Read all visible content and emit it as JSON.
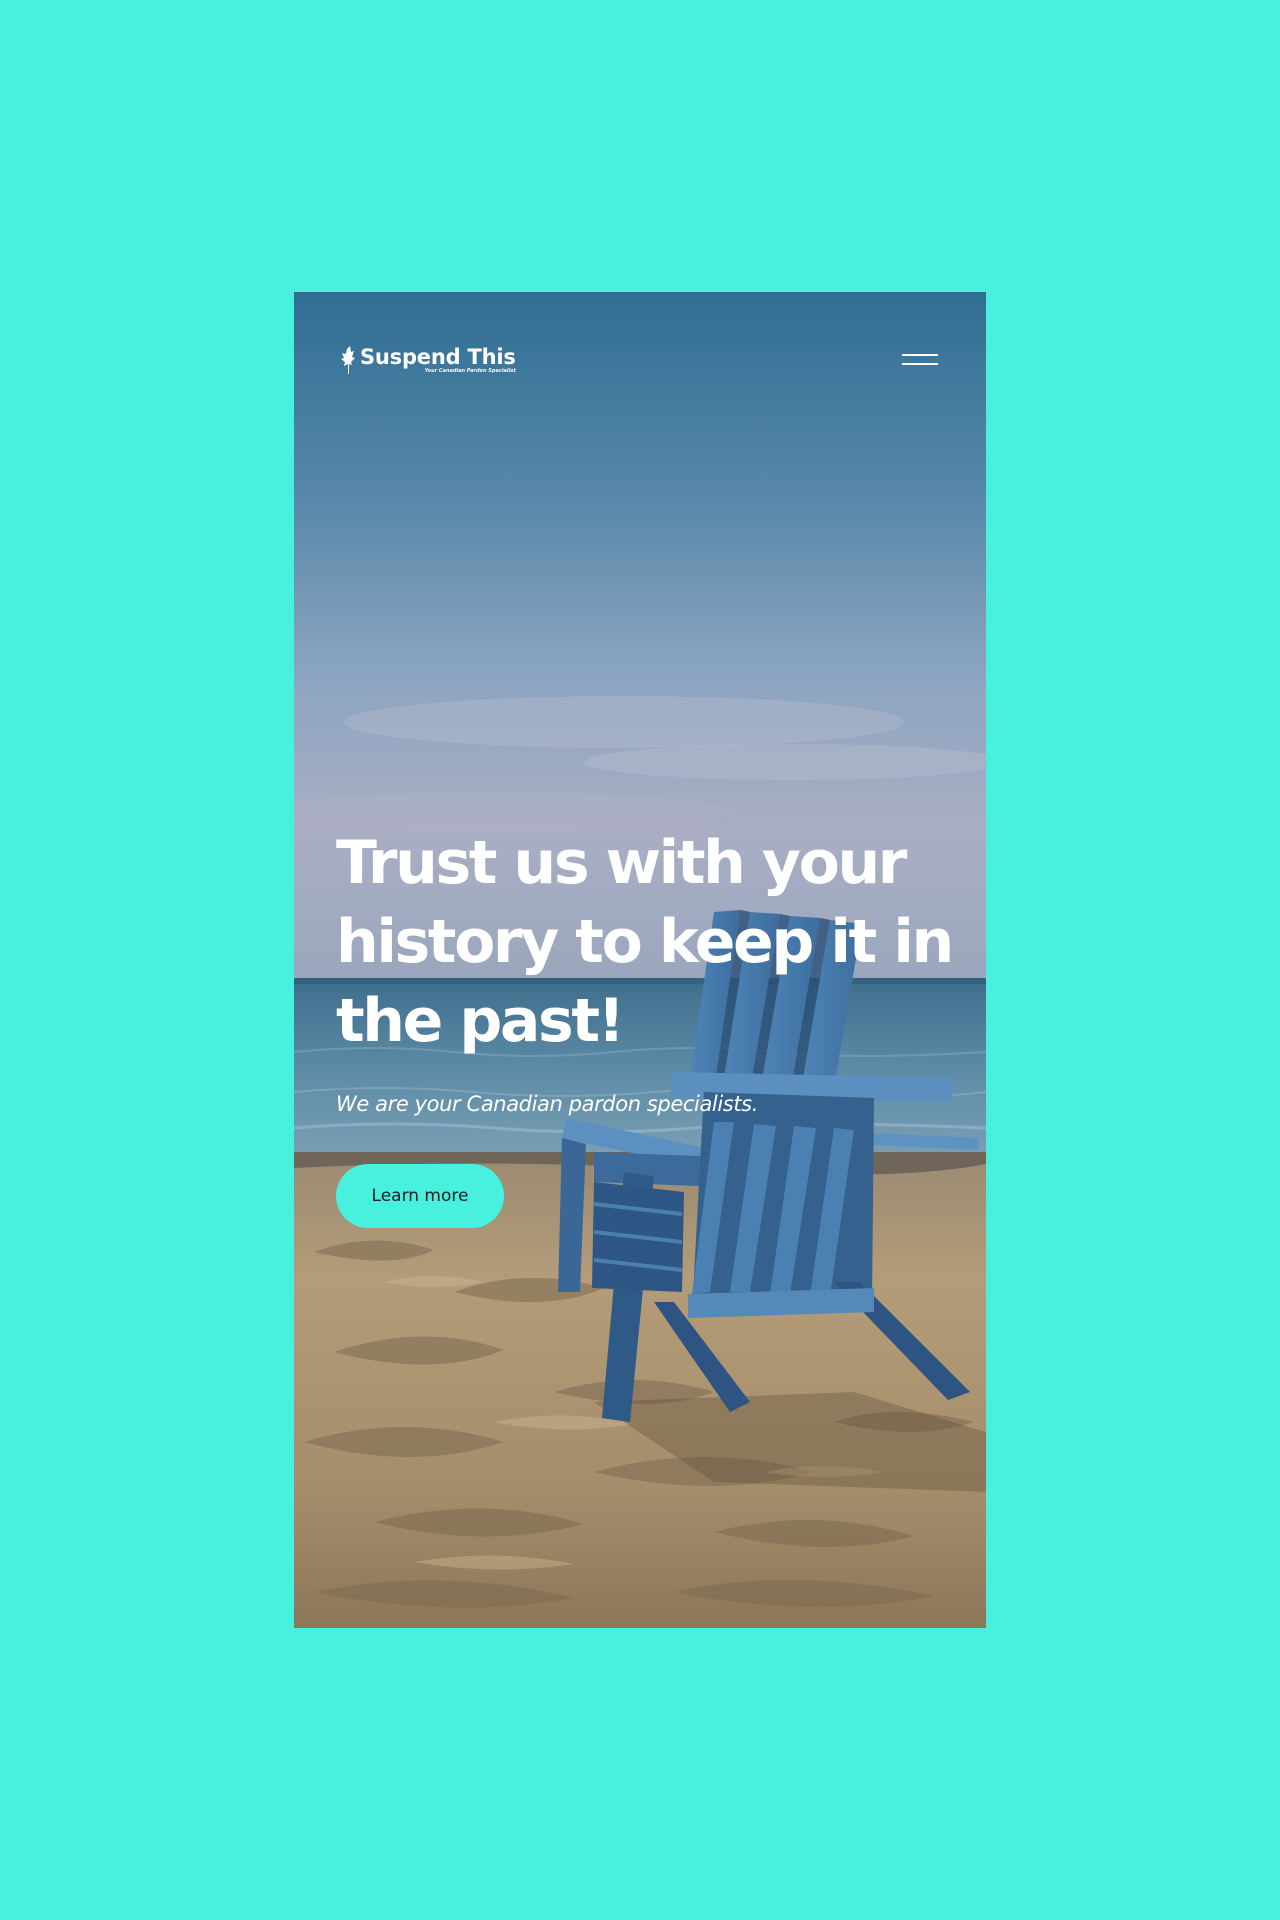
{
  "background_color": "#48f0de",
  "header": {
    "logo_name": "Suspend This",
    "logo_tagline": "Your Canadian Pardon Specialist",
    "logo_icon": "maple-leaf-icon",
    "menu_icon": "hamburger-menu-icon"
  },
  "hero": {
    "headline": "Trust us with your history to keep it in the past!",
    "subheadline": "We are your Canadian pardon specialists.",
    "cta_label": "Learn more",
    "cta_color": "#48f0de",
    "background_image": "beach-adirondack-chair-photo"
  }
}
